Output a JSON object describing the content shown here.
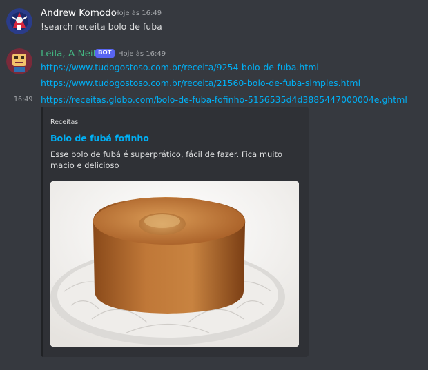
{
  "messages": [
    {
      "username": "Andrew Komodo",
      "username_color": "#ffffff",
      "timestamp": "Hoje às 16:49",
      "text": "!search receita bolo de fuba"
    },
    {
      "username": "Leila, A Neila",
      "username_color": "#43b581",
      "bot_tag": "BOT",
      "timestamp": "Hoje às 16:49",
      "links": [
        "https://www.tudogostoso.com.br/receita/9254-bolo-de-fuba.html",
        "https://www.tudogostoso.com.br/receita/21560-bolo-de-fuba-simples.html",
        "https://receitas.globo.com/bolo-de-fuba-fofinho-5156535d4d3885447000004e.ghtml"
      ],
      "side_time": "16:49"
    }
  ],
  "embed": {
    "provider": "Receitas",
    "title": "Bolo de fubá fofinho",
    "description": "Esse bolo de fubá é superprático, fácil de fazer. Fica muito macio e delicioso",
    "image_alt": "bolo-de-fuba-photo"
  },
  "colors": {
    "background": "#36393f",
    "link": "#00aff4",
    "embed_background": "#2f3136",
    "bot_tag": "#5865f2"
  }
}
